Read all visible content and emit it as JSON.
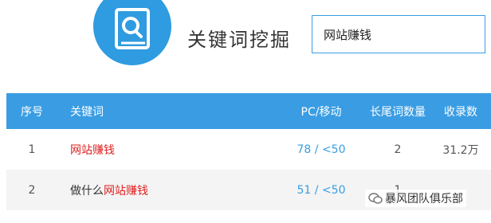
{
  "header": {
    "app_title": "关键词挖掘",
    "logo_icon": "book-search-icon",
    "search": {
      "value": "网站赚钱",
      "placeholder": ""
    }
  },
  "table": {
    "columns": [
      "序号",
      "关键词",
      "PC/移动",
      "长尾词数量",
      "收录数"
    ],
    "rows": [
      {
        "index": "1",
        "keyword_prefix": "",
        "keyword_highlight": "网站赚钱",
        "pc": "78",
        "sep": "/",
        "mobile": "<50",
        "longtail": "2",
        "indexed": "31.2万"
      },
      {
        "index": "2",
        "keyword_prefix": "做什么",
        "keyword_highlight": "网站赚钱",
        "pc": "51",
        "sep": "/",
        "mobile": "<50",
        "longtail": "1",
        "indexed": ""
      }
    ]
  },
  "watermark": {
    "text": "暴风团队俱乐部",
    "icon": "wechat-icon"
  },
  "colors": {
    "accent": "#3a9de3",
    "highlight": "#e02020"
  }
}
